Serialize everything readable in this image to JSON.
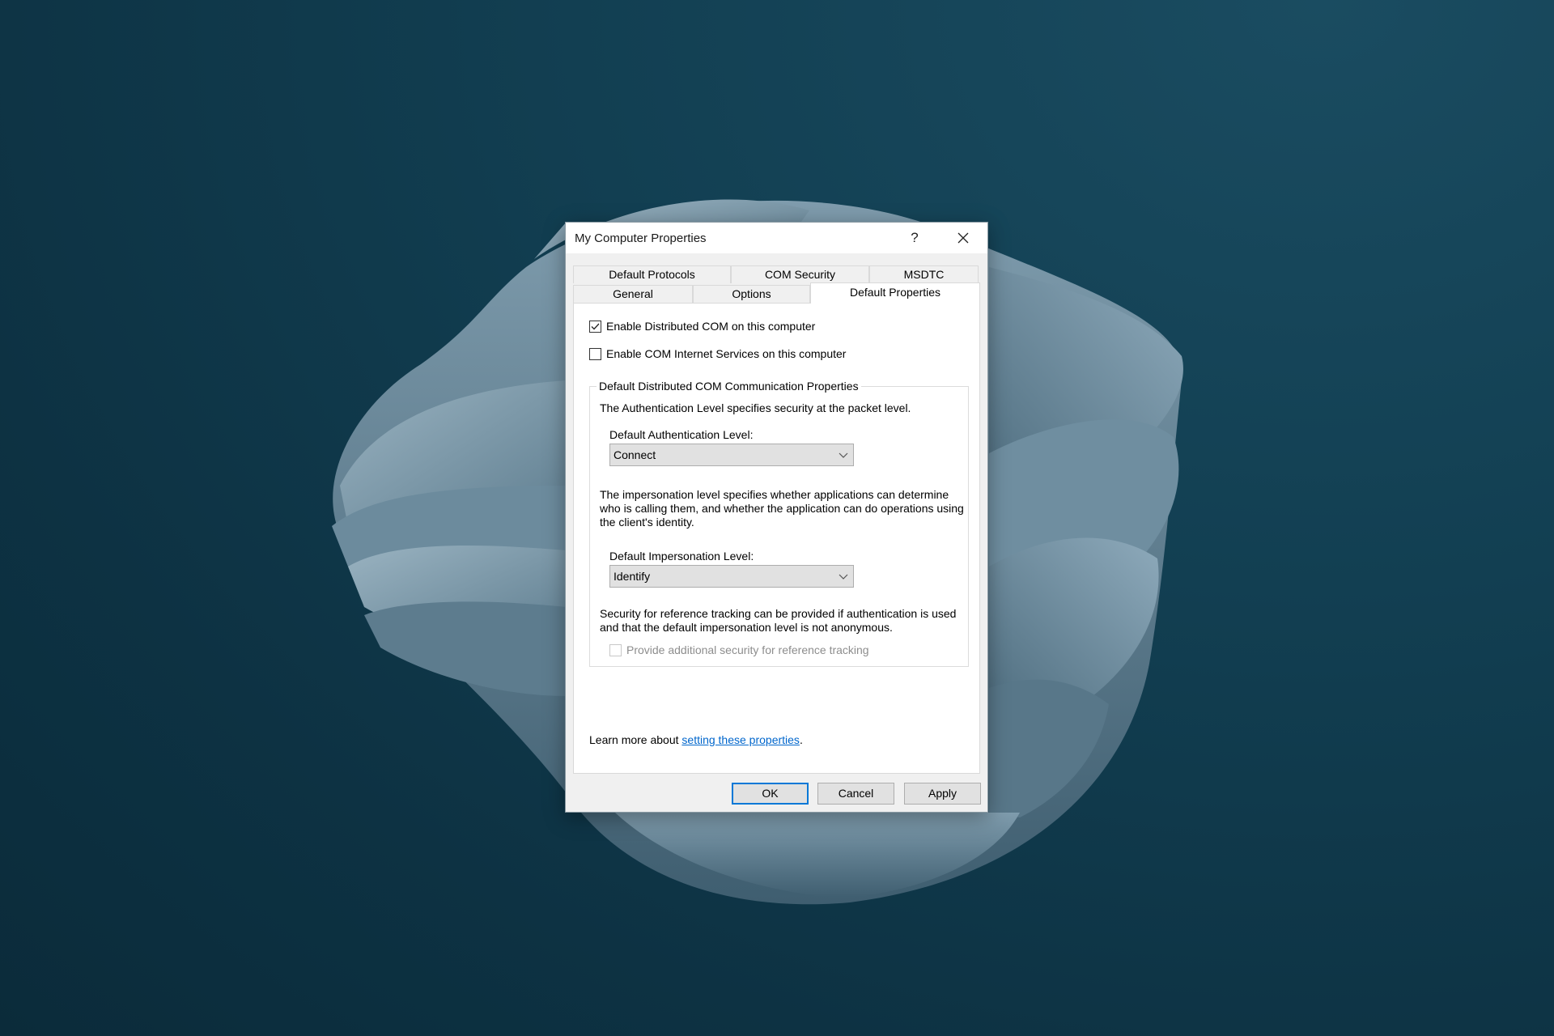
{
  "colors": {
    "accent": "#0078d7",
    "link": "#0066cc",
    "dialog_bg": "#f0f0f0",
    "panel_bg": "#ffffff",
    "desktop_bg": "#123f52",
    "bloom": "#7d9aab"
  },
  "dialog": {
    "title": "My Computer Properties",
    "help_icon": "question-mark-icon",
    "help_label": "?",
    "close_icon": "close-icon"
  },
  "tabs": {
    "row_back": [
      {
        "label": "Default Protocols",
        "selected": false
      },
      {
        "label": "COM Security",
        "selected": false
      },
      {
        "label": "MSDTC",
        "selected": false
      }
    ],
    "row_front": [
      {
        "label": "General",
        "selected": false
      },
      {
        "label": "Options",
        "selected": false
      },
      {
        "label": "Default Properties",
        "selected": true
      }
    ]
  },
  "panel": {
    "enable_dcom": {
      "label": "Enable Distributed COM on this computer",
      "checked": true
    },
    "enable_cis": {
      "label": "Enable COM Internet Services on this computer",
      "checked": false
    },
    "group": {
      "title": "Default Distributed COM Communication Properties",
      "auth_desc": "The Authentication Level specifies security at the packet level.",
      "auth_label": "Default Authentication Level:",
      "auth_value": "Connect",
      "imp_desc": "The impersonation level specifies whether applications can determine who is calling them, and whether the application can do operations using the client's identity.",
      "imp_label": "Default Impersonation Level:",
      "imp_value": "Identify",
      "ref_desc": "Security for reference tracking can be provided if authentication is used and that the default impersonation level is not anonymous.",
      "ref_checkbox": {
        "label": "Provide additional security for reference tracking",
        "checked": false,
        "disabled": true
      }
    },
    "learn_more_prefix": "Learn more about ",
    "learn_more_link": "setting these properties",
    "learn_more_suffix": "."
  },
  "buttons": {
    "ok": "OK",
    "cancel": "Cancel",
    "apply": "Apply"
  }
}
